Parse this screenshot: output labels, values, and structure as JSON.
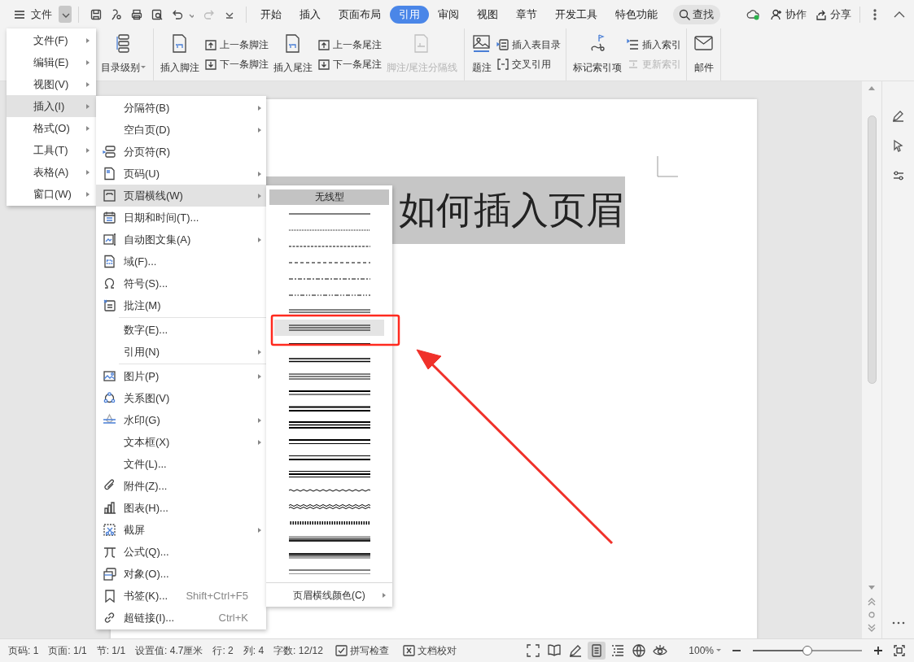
{
  "app_menu": {
    "label": "文件"
  },
  "tabs": [
    {
      "label": "开始",
      "selected": false
    },
    {
      "label": "插入",
      "selected": false
    },
    {
      "label": "页面布局",
      "selected": false
    },
    {
      "label": "引用",
      "selected": true
    },
    {
      "label": "审阅",
      "selected": false
    },
    {
      "label": "视图",
      "selected": false
    },
    {
      "label": "章节",
      "selected": false
    },
    {
      "label": "开发工具",
      "selected": false
    },
    {
      "label": "特色功能",
      "selected": false
    }
  ],
  "search": {
    "label": "查找"
  },
  "top_actions": [
    {
      "label": "协作"
    },
    {
      "label": "分享"
    }
  ],
  "ribbon": {
    "groups": [
      {
        "buttons": [
          {
            "label": "目录级别",
            "kind": "large",
            "disabled": false,
            "dropdown": true
          }
        ]
      },
      {
        "buttons": [
          {
            "label": "插入脚注",
            "kind": "large",
            "disabled": false,
            "dropdown": false
          },
          {
            "label": "上一条脚注",
            "kind": "small",
            "disabled": false,
            "dropdown": false
          },
          {
            "label": "下一条脚注",
            "kind": "small",
            "disabled": false,
            "dropdown": false
          },
          {
            "label": "插入尾注",
            "kind": "large",
            "disabled": false,
            "dropdown": false
          },
          {
            "label": "上一条尾注",
            "kind": "small",
            "disabled": false,
            "dropdown": false
          },
          {
            "label": "下一条尾注",
            "kind": "small",
            "disabled": false,
            "dropdown": false
          },
          {
            "label": "脚注/尾注分隔线",
            "kind": "large",
            "disabled": true,
            "dropdown": false
          }
        ]
      },
      {
        "buttons": [
          {
            "label": "题注",
            "kind": "large",
            "disabled": false,
            "dropdown": false
          },
          {
            "label": "插入表目录",
            "kind": "small",
            "disabled": false,
            "dropdown": false
          },
          {
            "label": "交叉引用",
            "kind": "small",
            "disabled": false,
            "dropdown": false
          }
        ]
      },
      {
        "buttons": [
          {
            "label": "标记索引项",
            "kind": "large",
            "disabled": false,
            "dropdown": false
          },
          {
            "label": "插入索引",
            "kind": "small",
            "disabled": false,
            "dropdown": false
          },
          {
            "label": "更新索引",
            "kind": "small",
            "disabled": true,
            "dropdown": false
          }
        ]
      },
      {
        "buttons": [
          {
            "label": "邮件",
            "kind": "large",
            "disabled": false,
            "dropdown": false
          }
        ]
      }
    ]
  },
  "main_menu": [
    {
      "label": "文件(F)",
      "selected": false
    },
    {
      "label": "编辑(E)",
      "selected": false
    },
    {
      "label": "视图(V)",
      "selected": false
    },
    {
      "label": "插入(I)",
      "selected": true
    },
    {
      "label": "格式(O)",
      "selected": false
    },
    {
      "label": "工具(T)",
      "selected": false
    },
    {
      "label": "表格(A)",
      "selected": false
    },
    {
      "label": "窗口(W)",
      "selected": false
    }
  ],
  "insert_menu": {
    "sections": [
      [
        {
          "label": "分隔符(B)",
          "submenu": true,
          "selected": false
        },
        {
          "label": "空白页(D)",
          "submenu": true,
          "selected": false
        },
        {
          "label": "分页符(R)",
          "submenu": false,
          "selected": false
        },
        {
          "label": "页码(U)",
          "submenu": true,
          "selected": false
        },
        {
          "label": "页眉横线(W)",
          "submenu": true,
          "selected": true
        },
        {
          "label": "日期和时间(T)...",
          "submenu": false,
          "selected": false
        },
        {
          "label": "自动图文集(A)",
          "submenu": true,
          "selected": false
        },
        {
          "label": "域(F)...",
          "submenu": false,
          "selected": false
        },
        {
          "label": "符号(S)...",
          "submenu": false,
          "selected": false
        },
        {
          "label": "批注(M)",
          "submenu": false,
          "selected": false
        }
      ],
      [
        {
          "label": "数字(E)...",
          "submenu": false,
          "selected": false
        },
        {
          "label": "引用(N)",
          "submenu": true,
          "selected": false
        }
      ],
      [
        {
          "label": "图片(P)",
          "submenu": true,
          "selected": false
        },
        {
          "label": "关系图(V)",
          "submenu": false,
          "selected": false
        },
        {
          "label": "水印(G)",
          "submenu": true,
          "selected": false
        },
        {
          "label": "文本框(X)",
          "submenu": true,
          "selected": false
        },
        {
          "label": "文件(L)...",
          "submenu": false,
          "selected": false
        },
        {
          "label": "附件(Z)...",
          "submenu": false,
          "selected": false
        },
        {
          "label": "图表(H)...",
          "submenu": false,
          "selected": false
        },
        {
          "label": "截屏",
          "submenu": true,
          "selected": false
        },
        {
          "label": "公式(Q)...",
          "submenu": false,
          "selected": false
        },
        {
          "label": "对象(O)...",
          "submenu": false,
          "selected": false
        },
        {
          "label": "书签(K)...",
          "submenu": false,
          "selected": false,
          "shortcut": "Shift+Ctrl+F5"
        },
        {
          "label": "超链接(I)...",
          "submenu": false,
          "selected": false,
          "shortcut": "Ctrl+K"
        }
      ]
    ]
  },
  "line_menu": {
    "header": "无线型",
    "styles": [
      {
        "kind": "solid",
        "selected": false
      },
      {
        "kind": "dotted",
        "selected": false
      },
      {
        "kind": "dash-short",
        "selected": false
      },
      {
        "kind": "dashed",
        "selected": false
      },
      {
        "kind": "dash-dot",
        "selected": false
      },
      {
        "kind": "dash-dot-dot",
        "selected": false
      },
      {
        "kind": "double",
        "selected": false
      },
      {
        "kind": "triple",
        "selected": true
      },
      {
        "kind": "thick",
        "selected": false
      },
      {
        "kind": "double-thick",
        "selected": false
      },
      {
        "kind": "triple-medium",
        "selected": false
      },
      {
        "kind": "thick-thin",
        "selected": false
      },
      {
        "kind": "thick-thick",
        "selected": false
      },
      {
        "kind": "thick-thin-thick",
        "selected": false
      },
      {
        "kind": "medium-thin",
        "selected": false
      },
      {
        "kind": "thin-medium",
        "selected": false
      },
      {
        "kind": "thin-thick-thin",
        "selected": false
      },
      {
        "kind": "wave",
        "selected": false
      },
      {
        "kind": "double-wave",
        "selected": false
      },
      {
        "kind": "hatched",
        "selected": false
      },
      {
        "kind": "gradient-top",
        "selected": false
      },
      {
        "kind": "gradient-bottom",
        "selected": false
      },
      {
        "kind": "thin-gray-double",
        "selected": false
      }
    ],
    "color_item": {
      "label": "页眉横线颜色(C)"
    }
  },
  "document": {
    "title": "如何插入页眉"
  },
  "status_bar": {
    "fields": [
      "页码: 1",
      "页面: 1/1",
      "节: 1/1",
      "设置值: 4.7厘米",
      "行: 2",
      "列: 4",
      "字数: 12/12"
    ],
    "checks": [
      {
        "label": "拼写检查"
      },
      {
        "label": "文档校对"
      }
    ],
    "view_modes": [
      {
        "selected": false
      },
      {
        "selected": false
      },
      {
        "selected": false
      },
      {
        "selected": true
      },
      {
        "selected": false
      },
      {
        "selected": false
      },
      {
        "selected": false
      }
    ],
    "zoom": {
      "label": "100%",
      "level": 0.5
    }
  }
}
